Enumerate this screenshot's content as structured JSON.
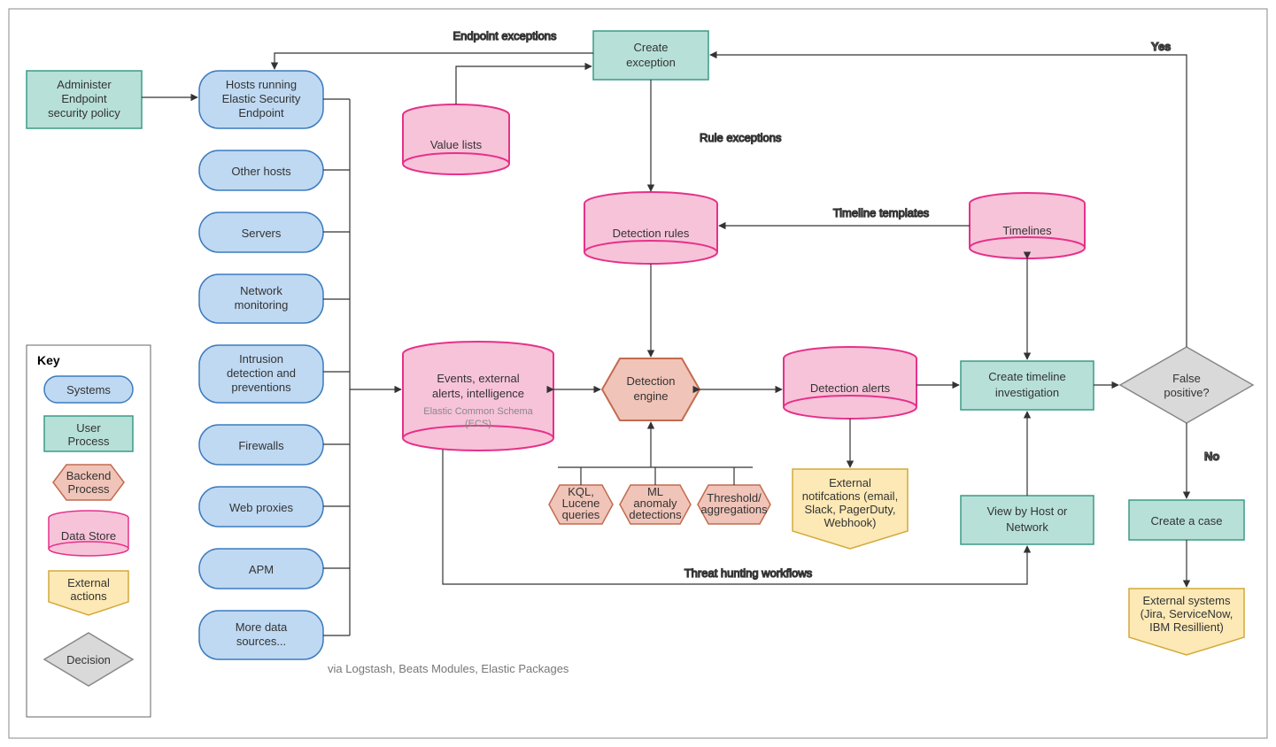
{
  "key": {
    "title": "Key",
    "systems": "Systems",
    "user_process": "User Process",
    "backend_process": "Backend Process",
    "data_store": "Data Store",
    "external_actions": "External actions",
    "decision": "Decision"
  },
  "nodes": {
    "admin_policy_l1": "Administer",
    "admin_policy_l2": "Endpoint",
    "admin_policy_l3": "security policy",
    "hosts_running_l1": "Hosts running",
    "hosts_running_l2": "Elastic Security",
    "hosts_running_l3": "Endpoint",
    "other_hosts": "Other hosts",
    "servers": "Servers",
    "network_mon_l1": "Network",
    "network_mon_l2": "monitoring",
    "idp_l1": "Intrusion",
    "idp_l2": "detection and",
    "idp_l3": "preventions",
    "firewalls": "Firewalls",
    "web_proxies": "Web proxies",
    "apm": "APM",
    "more_sources_l1": "More data",
    "more_sources_l2": "sources...",
    "value_lists": "Value lists",
    "create_exception_l1": "Create",
    "create_exception_l2": "exception",
    "detection_rules": "Detection rules",
    "events_l1": "Events, external",
    "events_l2": "alerts, intelligence",
    "events_sub_l1": "Elastic Common Schema",
    "events_sub_l2": "(ECS)",
    "detection_engine_l1": "Detection",
    "detection_engine_l2": "engine",
    "kql_l1": "KQL,",
    "kql_l2": "Lucene",
    "kql_l3": "queries",
    "ml_l1": "ML",
    "ml_l2": "anomaly",
    "ml_l3": "detections",
    "threshold_l1": "Threshold/",
    "threshold_l2": "aggregations",
    "detection_alerts": "Detection alerts",
    "ext_notif_l1": "External",
    "ext_notif_l2": "notifcations (email,",
    "ext_notif_l3": "Slack, PagerDuty,",
    "ext_notif_l4": "Webhook)",
    "timelines": "Timelines",
    "create_timeline_l1": "Create timeline",
    "create_timeline_l2": "investigation",
    "view_host_l1": "View by Host or",
    "view_host_l2": "Network",
    "false_positive_l1": "False",
    "false_positive_l2": "positive?",
    "create_case": "Create a case",
    "ext_systems_l1": "External systems",
    "ext_systems_l2": "(Jira, ServiceNow,",
    "ext_systems_l3": "IBM Resillient)"
  },
  "edges": {
    "endpoint_exceptions": "Endpoint exceptions",
    "rule_exceptions": "Rule exceptions",
    "timeline_templates": "Timeline templates",
    "threat_hunting": "Threat hunting workflows",
    "yes": "Yes",
    "no": "No",
    "via_logstash": "via Logstash, Beats Modules, Elastic Packages"
  }
}
